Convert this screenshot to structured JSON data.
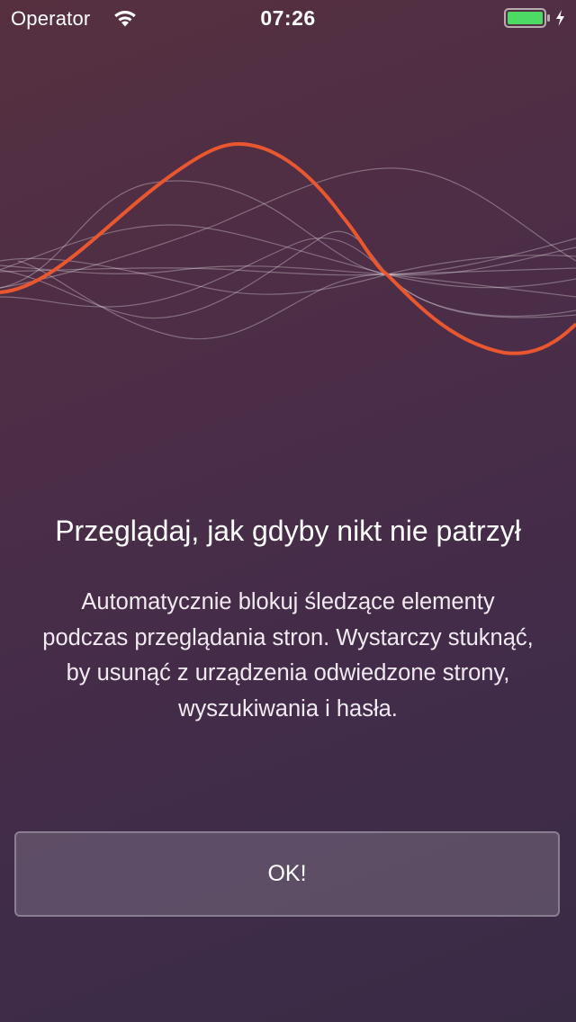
{
  "status_bar": {
    "carrier": "Operator",
    "time": "07:26",
    "icons": [
      "wifi-icon",
      "battery-icon",
      "charging-bolt-icon"
    ],
    "battery_color": "#4cd964"
  },
  "illustration": {
    "icon": "sine-wave-illustration",
    "accent_color": "#e8572f"
  },
  "onboarding": {
    "title": "Przeglądaj, jak gdyby nikt nie patrzył",
    "description": "Automatycznie blokuj śledzące elementy podczas przeglądania stron. Wystarczy stuknąć, by usunąć z urządzenia odwiedzone strony, wyszukiwania i hasła.",
    "ok_label": "OK!"
  }
}
